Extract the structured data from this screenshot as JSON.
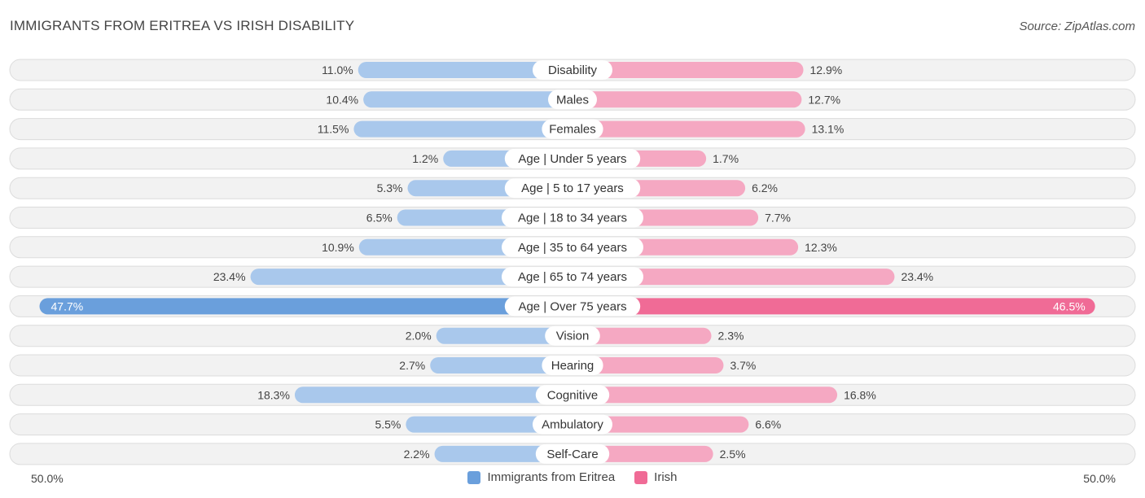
{
  "header": {
    "title": "IMMIGRANTS FROM ERITREA VS IRISH DISABILITY",
    "source": "Source: ZipAtlas.com"
  },
  "axis": {
    "left_label": "50.0%",
    "right_label": "50.0%"
  },
  "legend": [
    {
      "name": "Immigrants from Eritrea",
      "color": "#6a9fdc"
    },
    {
      "name": "Irish",
      "color": "#f06b96"
    }
  ],
  "colors": {
    "left_light": "#a9c8ec",
    "left_strong": "#6a9fdc",
    "right_light": "#f5a8c2",
    "right_strong": "#f06b96"
  },
  "chart_data": {
    "type": "bar",
    "orientation": "horizontal-diverging",
    "title": "IMMIGRANTS FROM ERITREA VS IRISH DISABILITY",
    "xlim": [
      -50,
      50
    ],
    "categories": [
      "Disability",
      "Males",
      "Females",
      "Age | Under 5 years",
      "Age | 5 to 17 years",
      "Age | 18 to 34 years",
      "Age | 35 to 64 years",
      "Age | 65 to 74 years",
      "Age | Over 75 years",
      "Vision",
      "Hearing",
      "Cognitive",
      "Ambulatory",
      "Self-Care"
    ],
    "series": [
      {
        "name": "Immigrants from Eritrea",
        "values": [
          11.0,
          10.4,
          11.5,
          1.2,
          5.3,
          6.5,
          10.9,
          23.4,
          47.7,
          2.0,
          2.7,
          18.3,
          5.5,
          2.2
        ],
        "labels": [
          "11.0%",
          "10.4%",
          "11.5%",
          "1.2%",
          "5.3%",
          "6.5%",
          "10.9%",
          "23.4%",
          "47.7%",
          "2.0%",
          "2.7%",
          "18.3%",
          "5.5%",
          "2.2%"
        ]
      },
      {
        "name": "Irish",
        "values": [
          12.9,
          12.7,
          13.1,
          1.7,
          6.2,
          7.7,
          12.3,
          23.4,
          46.5,
          2.3,
          3.7,
          16.8,
          6.6,
          2.5
        ],
        "labels": [
          "12.9%",
          "12.7%",
          "13.1%",
          "1.7%",
          "6.2%",
          "7.7%",
          "12.3%",
          "23.4%",
          "46.5%",
          "2.3%",
          "3.7%",
          "16.8%",
          "6.6%",
          "2.5%"
        ]
      }
    ],
    "legend_position": "bottom-center"
  }
}
